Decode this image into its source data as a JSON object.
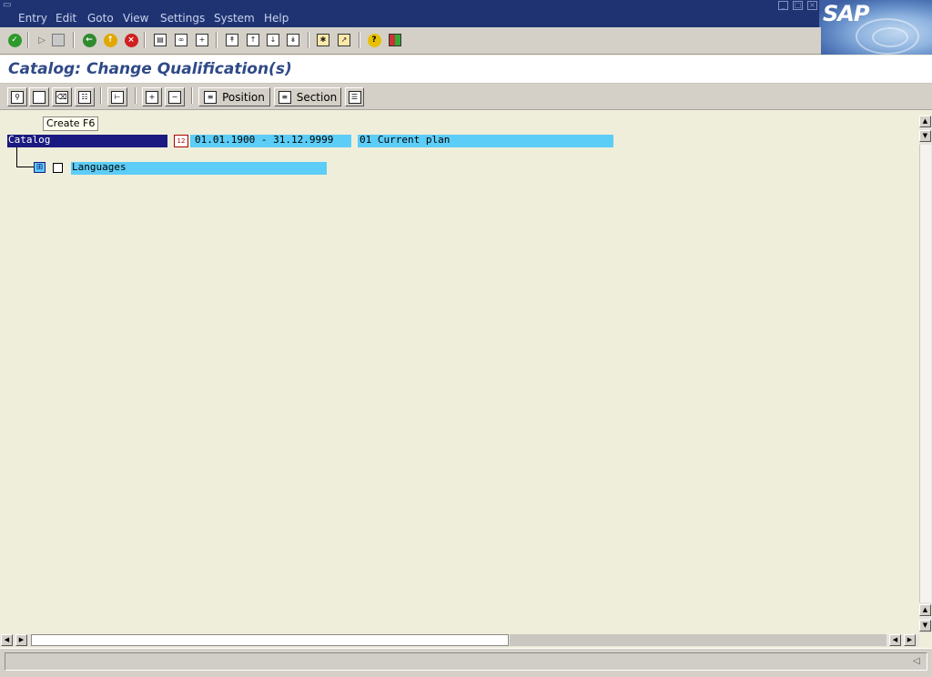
{
  "menu": {
    "items": [
      {
        "label": "Entry"
      },
      {
        "label": "Edit"
      },
      {
        "label": "Goto"
      },
      {
        "label": "View"
      },
      {
        "label": "Settings"
      },
      {
        "label": "System"
      },
      {
        "label": "Help"
      }
    ]
  },
  "brand": {
    "logo_text": "SAP",
    "accent": "#1f3372"
  },
  "page": {
    "title": "Catalog: Change Qualification(s)"
  },
  "app_toolbar": {
    "position_label": "Position",
    "section_label": "Section"
  },
  "tooltip": {
    "text": "Create  F6"
  },
  "tree": {
    "root": {
      "label": "Catalog",
      "validity": "01.01.1900 - 31.12.9999",
      "plan": "01 Current plan"
    },
    "nodes": [
      {
        "label": "Languages"
      }
    ]
  },
  "colors": {
    "selection_bg": "#1a1a80",
    "node_bg": "#5ccdf7",
    "workarea_bg": "#efeedb"
  }
}
